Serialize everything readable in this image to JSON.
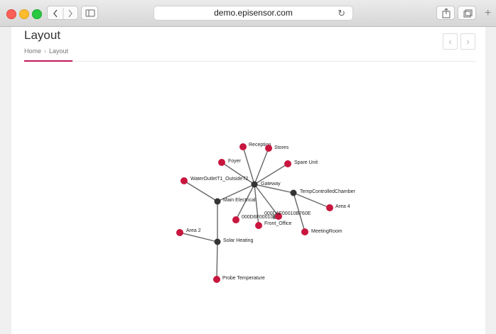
{
  "browser": {
    "url": "demo.episensor.com"
  },
  "page": {
    "title": "Layout",
    "breadcrumb": [
      "Home",
      "Layout"
    ]
  },
  "graph": {
    "colors": {
      "hub": "#333333",
      "leaf": "#c8163e",
      "edge": "#666666"
    },
    "nodes": [
      {
        "id": "gateway",
        "label": "Gateway",
        "type": "hub"
      },
      {
        "id": "main_electrical",
        "label": "Main Electrical",
        "type": "hub"
      },
      {
        "id": "temp_chamber",
        "label": "TempControlledChamber",
        "type": "hub"
      },
      {
        "id": "solar_heating",
        "label": "Solar Heating",
        "type": "hub"
      },
      {
        "id": "reception",
        "label": "Reception",
        "type": "leaf"
      },
      {
        "id": "stores",
        "label": "Stores",
        "type": "leaf"
      },
      {
        "id": "foyer",
        "label": "Foyer",
        "type": "leaf"
      },
      {
        "id": "spare_unit",
        "label": "Spare Unit",
        "type": "leaf"
      },
      {
        "id": "water_outlet",
        "label": "WaterOutletT1_OutsideT2",
        "type": "leaf"
      },
      {
        "id": "area4",
        "label": "Area 4",
        "type": "leaf"
      },
      {
        "id": "dev1",
        "label": "000D6F00010B",
        "type": "leaf"
      },
      {
        "id": "dev1b",
        "label": "B4",
        "type": "leaf"
      },
      {
        "id": "dev2",
        "label": "000D6F00010B760E",
        "type": "leaf"
      },
      {
        "id": "front_office",
        "label": "Front_Office",
        "type": "leaf"
      },
      {
        "id": "meeting_room",
        "label": "MeetingRoom",
        "type": "leaf"
      },
      {
        "id": "area2",
        "label": "Area 2",
        "type": "leaf"
      },
      {
        "id": "probe_temp",
        "label": "Probe Temperature",
        "type": "leaf"
      }
    ],
    "edges": [
      [
        "gateway",
        "reception"
      ],
      [
        "gateway",
        "stores"
      ],
      [
        "gateway",
        "foyer"
      ],
      [
        "gateway",
        "spare_unit"
      ],
      [
        "gateway",
        "main_electrical"
      ],
      [
        "gateway",
        "temp_chamber"
      ],
      [
        "gateway",
        "dev1"
      ],
      [
        "gateway",
        "dev2"
      ],
      [
        "gateway",
        "front_office"
      ],
      [
        "main_electrical",
        "water_outlet"
      ],
      [
        "main_electrical",
        "solar_heating"
      ],
      [
        "temp_chamber",
        "area4"
      ],
      [
        "temp_chamber",
        "meeting_room"
      ],
      [
        "solar_heating",
        "area2"
      ],
      [
        "solar_heating",
        "probe_temp"
      ]
    ]
  }
}
